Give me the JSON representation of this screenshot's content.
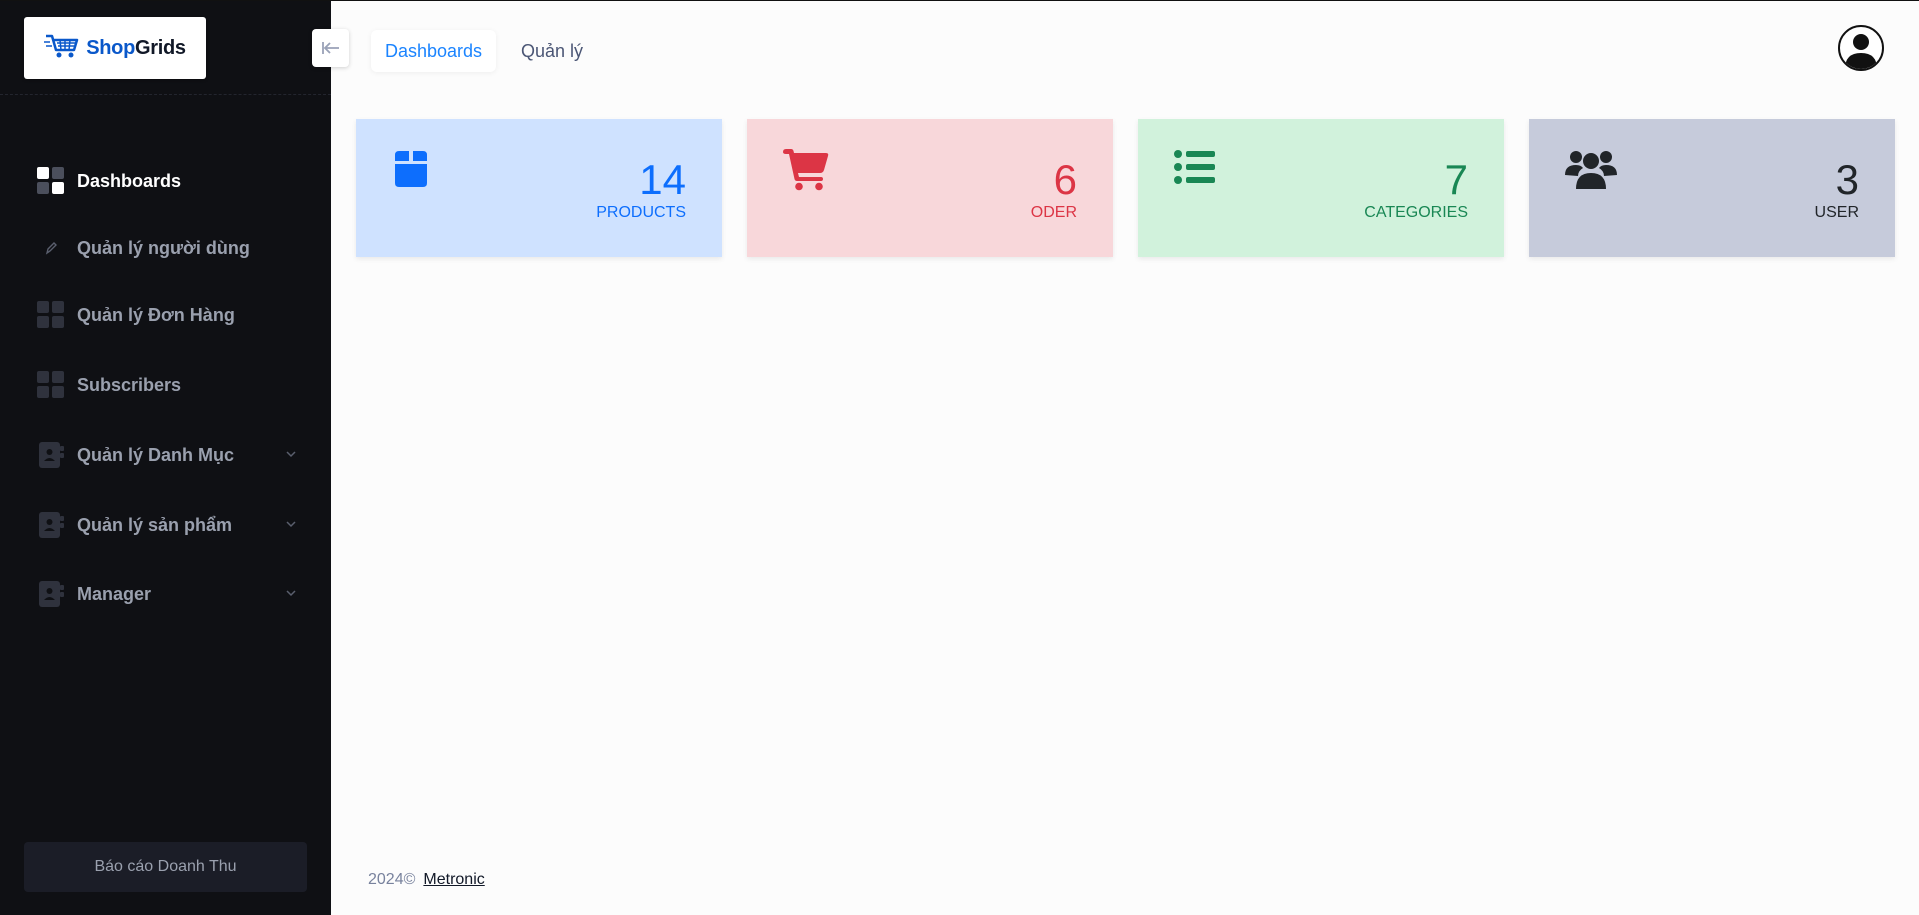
{
  "brand": {
    "part1": "Shop",
    "part2": "Grids"
  },
  "sidebar": {
    "items": [
      {
        "label": "Dashboards",
        "icon": "dashboard-grid-icon",
        "active": true
      },
      {
        "label": "Quản lý người dùng",
        "icon": "pen-icon"
      },
      {
        "label": "Quản lý Đơn Hàng",
        "icon": "grid-icon"
      },
      {
        "label": "Subscribers",
        "icon": "grid-icon"
      },
      {
        "label": "Quản lý Danh Mục",
        "icon": "contact-card-icon",
        "has_submenu": true
      },
      {
        "label": "Quản lý sản phẩm",
        "icon": "contact-card-icon",
        "has_submenu": true
      },
      {
        "label": "Manager",
        "icon": "contact-card-icon",
        "has_submenu": true
      }
    ],
    "report_button": "Báo cáo Doanh Thu"
  },
  "header": {
    "tabs": [
      {
        "label": "Dashboards",
        "active": true
      },
      {
        "label": "Quản lý"
      }
    ]
  },
  "stats": [
    {
      "value": "14",
      "label": "PRODUCTS",
      "icon": "box-icon",
      "bg": "#cfe2ff",
      "color": "#0d6efd"
    },
    {
      "value": "6",
      "label": "ODER",
      "icon": "cart-icon",
      "bg": "#f8d7da",
      "color": "#dc3545"
    },
    {
      "value": "7",
      "label": "CATEGORIES",
      "icon": "list-icon",
      "bg": "#d1f2dc",
      "color": "#198754"
    },
    {
      "value": "3",
      "label": "USER",
      "icon": "users-icon",
      "bg": "#c6cbdb",
      "color": "#212529"
    }
  ],
  "footer": {
    "year": "2024©",
    "link": "Metronic"
  }
}
